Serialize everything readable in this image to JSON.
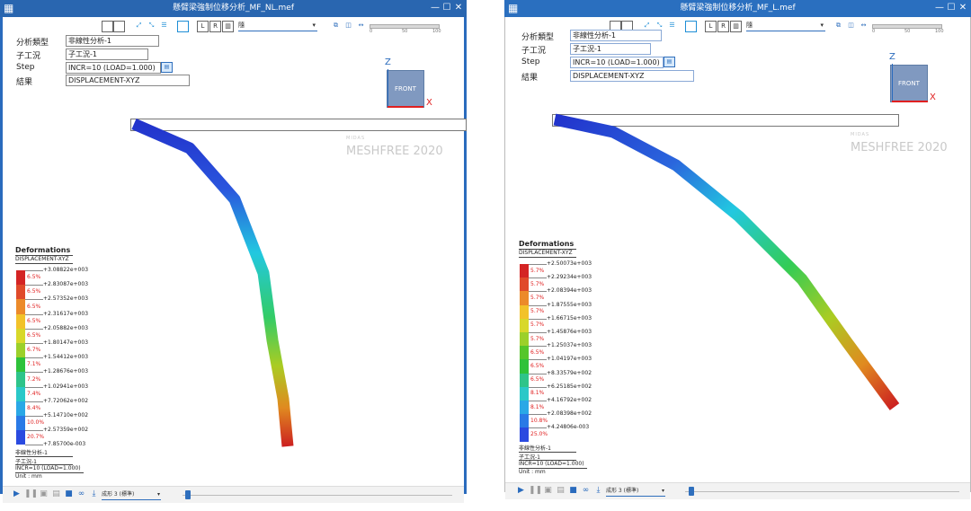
{
  "colors": {
    "titlebar": "#2966b0",
    "accent": "#2f6fbd",
    "axis_x": "#e02020",
    "axis_z": "#2a6bbd"
  },
  "windows": [
    {
      "title": "懸臂梁強制位移分析_MF_NL.mef",
      "toolbar": {
        "dropdown_value": "隨",
        "slider_ticks": [
          "0",
          "50",
          "100"
        ]
      },
      "props": {
        "type_label": "分析類型",
        "type_value": "非線性分析-1",
        "sub_label": "子工況",
        "sub_value": "子工況-1",
        "step_label": "Step",
        "step_value": "INCR=10 (LOAD=1.000)",
        "result_label": "結果",
        "result_value": "DISPLACEMENT-XYZ"
      },
      "view": {
        "cube_label": "FRONT",
        "axis_z": "Z",
        "axis_x": "X"
      },
      "brand": {
        "mini": "MIDAS",
        "main": "MESHFREE 2020"
      },
      "legend": {
        "title": "Deformations",
        "subtitle": "DISPLACEMENT-XYZ",
        "values": [
          "+3.08822e+003",
          "+2.83087e+003",
          "+2.57352e+003",
          "+2.31617e+003",
          "+2.05882e+003",
          "+1.80147e+003",
          "+1.54412e+003",
          "+1.28676e+003",
          "+1.02941e+003",
          "+7.72062e+002",
          "+5.14710e+002",
          "+2.57359e+002",
          "+7.85700e-003"
        ],
        "percents": [
          "6.5%",
          "6.5%",
          "6.5%",
          "6.5%",
          "6.5%",
          "6.7%",
          "7.1%",
          "7.2%",
          "7.4%",
          "8.4%",
          "10.0%",
          "20.7%"
        ],
        "footer_analysis": "非線性分析-1",
        "footer_sub": "子工況-1",
        "footer_step": "INCR=10 (LOAD=1.000)",
        "footer_unit": "Unit : mm"
      },
      "bottombar": {
        "dropdown_value": "成形 3 (標準)"
      }
    },
    {
      "title": "懸臂梁強制位移分析_MF_L.mef",
      "toolbar": {
        "dropdown_value": "隨",
        "slider_ticks": [
          "0",
          "50",
          "100"
        ]
      },
      "props": {
        "type_label": "分析類型",
        "type_value": "非線性分析-1",
        "sub_label": "子工況",
        "sub_value": "子工況-1",
        "step_label": "Step",
        "step_value": "INCR=10 (LOAD=1.000)",
        "result_label": "結果",
        "result_value": "DISPLACEMENT-XYZ"
      },
      "view": {
        "cube_label": "FRONT",
        "axis_z": "Z",
        "axis_x": "X"
      },
      "brand": {
        "mini": "MIDAS",
        "main": "MESHFREE 2020"
      },
      "legend": {
        "title": "Deformations",
        "subtitle": "DISPLACEMENT-XYZ",
        "values": [
          "+2.50073e+003",
          "+2.29234e+003",
          "+2.08394e+003",
          "+1.87555e+003",
          "+1.66715e+003",
          "+1.45876e+003",
          "+1.25037e+003",
          "+1.04197e+003",
          "+8.33579e+002",
          "+6.25185e+002",
          "+4.16792e+002",
          "+2.08398e+002",
          "+4.24806e-003"
        ],
        "percents": [
          "5.7%",
          "5.7%",
          "5.7%",
          "5.7%",
          "5.7%",
          "5.7%",
          "6.5%",
          "6.5%",
          "6.5%",
          "8.1%",
          "8.1%",
          "10.8%",
          "25.0%"
        ],
        "footer_analysis": "非線性分析-1",
        "footer_sub": "子工況-1",
        "footer_step": "INCR=10 (LOAD=1.000)",
        "footer_unit": "Unit : mm"
      },
      "bottombar": {
        "dropdown_value": "成形 3 (標準)"
      }
    }
  ]
}
